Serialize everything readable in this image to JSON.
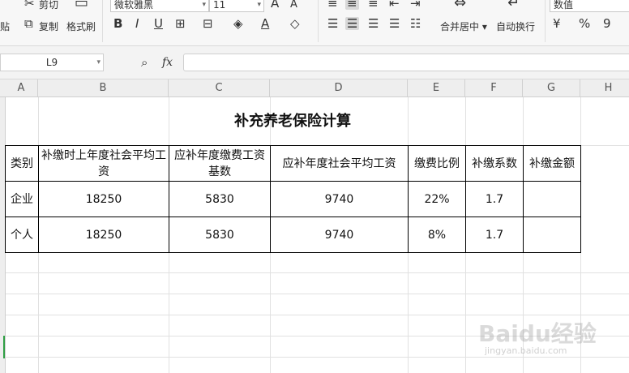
{
  "ribbon": {
    "cut_label": "剪切",
    "paste_partial_label": "贴",
    "copy_label": "复制",
    "format_painter_label": "格式刷",
    "font_name": "微软雅黑",
    "font_size": "11",
    "merge_center_label": "合并居中",
    "auto_wrap_label": "自动换行",
    "number_format": "数值",
    "percent_symbol": "%",
    "thousands_symbol": "9",
    "bold_glyph": "B",
    "italic_glyph": "I",
    "underline_glyph": "U"
  },
  "formula_bar": {
    "name_box": "L9",
    "fx_label": "fx",
    "content": ""
  },
  "columns": [
    "A",
    "B",
    "C",
    "D",
    "E",
    "F",
    "G",
    "H"
  ],
  "sheet": {
    "title": "补充养老保险计算",
    "headers": [
      "类别",
      "补缴时上年度社会平均工资",
      "应补年度缴费工资基数",
      "应补年度社会平均工资",
      "缴费比例",
      "补缴系数",
      "补缴金额"
    ],
    "rows": [
      [
        "企业",
        "18250",
        "5830",
        "9740",
        "22%",
        "1.7",
        ""
      ],
      [
        "个人",
        "18250",
        "5830",
        "9740",
        "8%",
        "1.7",
        ""
      ]
    ]
  },
  "watermark": {
    "text": "Baidu经验",
    "url_text": "jingyan.baidu.com"
  }
}
